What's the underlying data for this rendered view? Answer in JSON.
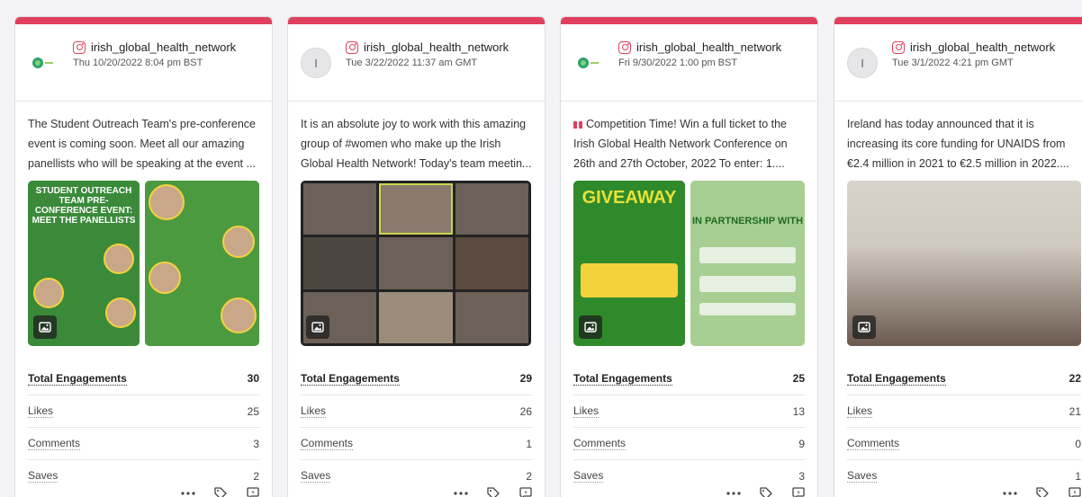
{
  "colors": {
    "accent": "#e0405d",
    "metric_divider": "#e4e5ea"
  },
  "icons": {
    "platform": "instagram-icon",
    "media": "photo-icon",
    "more": "more-icon",
    "tag": "tag-icon",
    "boost": "boost-icon"
  },
  "posts": [
    {
      "avatar": "",
      "handle": "irish_global_health_network",
      "date": "Thu 10/20/2022 8:04 pm BST",
      "text": "The Student Outreach Team's pre-conference event is coming soon. Meet all our amazing panellists who will be speaking at the event ...",
      "poster_title": "STUDENT OUTREACH TEAM PRE-CONFERENCE EVENT: MEET THE PANELLISTS",
      "metrics": {
        "total_label": "Total Engagements",
        "total": "30",
        "likes_label": "Likes",
        "likes": "25",
        "comments_label": "Comments",
        "comments": "3",
        "saves_label": "Saves",
        "saves": "2"
      }
    },
    {
      "avatar": "I",
      "handle": "irish_global_health_network",
      "date": "Tue 3/22/2022 11:37 am GMT",
      "text": "It is an absolute joy to work with this amazing group of #women who make up the Irish Global Health Network! Today's team meetin...",
      "metrics": {
        "total_label": "Total Engagements",
        "total": "29",
        "likes_label": "Likes",
        "likes": "26",
        "comments_label": "Comments",
        "comments": "1",
        "saves_label": "Saves",
        "saves": "2"
      }
    },
    {
      "avatar": "",
      "handle": "irish_global_health_network",
      "date": "Fri 9/30/2022 1:00 pm BST",
      "text": "Competition Time! Win a full ticket to the Irish Global Health Network Conference on 26th and 27th October, 2022 To enter: 1....",
      "poster_title": "GIVEAWAY",
      "poster_title2": "IN PARTNERSHIP WITH",
      "metrics": {
        "total_label": "Total Engagements",
        "total": "25",
        "likes_label": "Likes",
        "likes": "13",
        "comments_label": "Comments",
        "comments": "9",
        "saves_label": "Saves",
        "saves": "3"
      }
    },
    {
      "avatar": "I",
      "handle": "irish_global_health_network",
      "date": "Tue 3/1/2022 4:21 pm GMT",
      "text": "Ireland has today announced that it is increasing its core funding for UNAIDS from €2.4 million in 2021 to €2.5 million in 2022....",
      "metrics": {
        "total_label": "Total Engagements",
        "total": "22",
        "likes_label": "Likes",
        "likes": "21",
        "comments_label": "Comments",
        "comments": "0",
        "saves_label": "Saves",
        "saves": "1"
      }
    }
  ]
}
